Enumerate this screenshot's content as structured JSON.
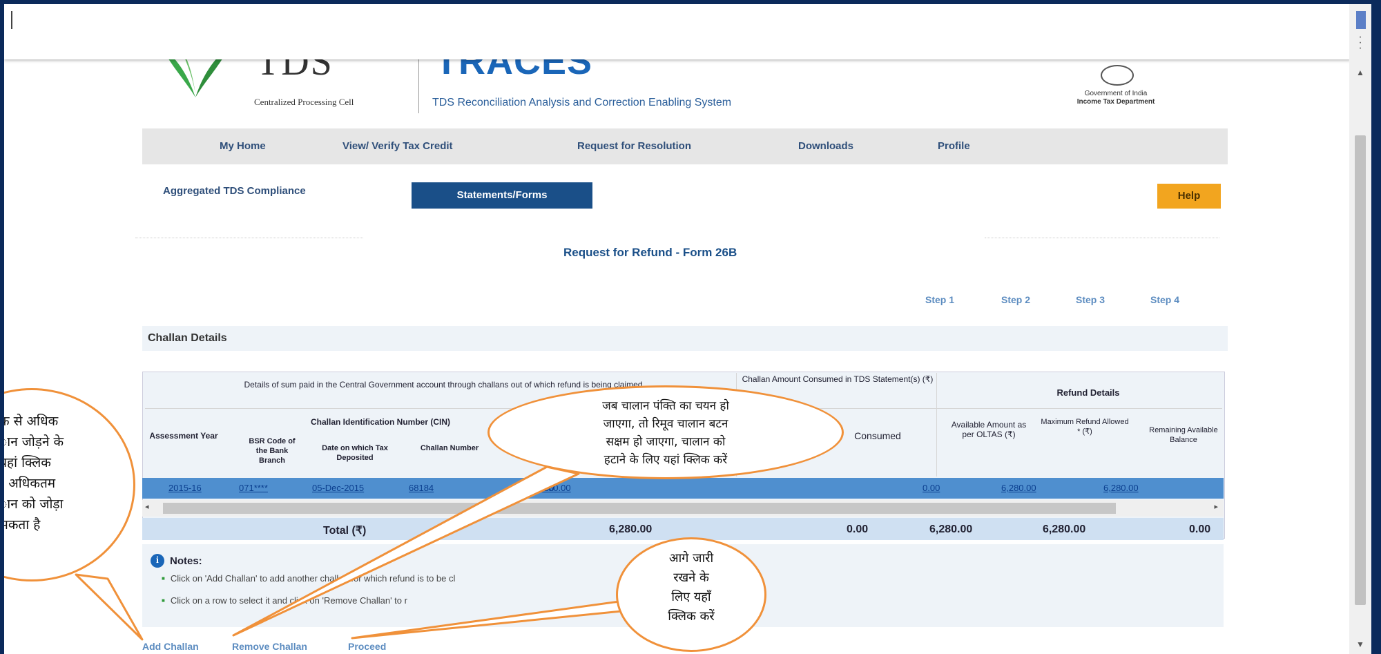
{
  "header": {
    "tds_logo_text": "TDS",
    "tds_subtitle": "Centralized Processing Cell",
    "traces_title": "TRACES",
    "traces_subtitle": "TDS Reconciliation Analysis and Correction Enabling System",
    "gov_text_line1": "Government of India",
    "gov_text_line2": "Income Tax Department"
  },
  "nav": {
    "items": [
      "My Home",
      "View/ Verify Tax Credit",
      "Request for Resolution",
      "Downloads",
      "Profile"
    ]
  },
  "subnav": {
    "aggregated": "Aggregated TDS Compliance",
    "statements": "Statements/Forms",
    "help": "Help"
  },
  "page": {
    "heading": "Request for Refund - Form 26B",
    "steps": [
      "Step 1",
      "Step 2",
      "Step 3",
      "Step 4"
    ],
    "section_title": "Challan Details"
  },
  "table": {
    "group_sum_paid": "Details of sum paid in the Central Government account through challans out of which refund is being claimed",
    "group_consumed": "Challan Amount Consumed in TDS Statement(s) (₹)",
    "group_refund": "Refund Details",
    "group_cin": "Challan Identification Number (CIN)",
    "col_assessment": "Assessment Year",
    "col_bsr": "BSR Code of the Bank Branch",
    "col_date": "Date on which Tax Deposited",
    "col_challan": "Challan Number",
    "col_consumed": "Consumed",
    "col_available": "Available Amount as per OLTAS (₹)",
    "col_maximum": "Maximum Refund Allowed * (₹)",
    "col_remaining": "Remaining Available Balance",
    "row": {
      "assessment_year": "2015-16",
      "bsr": "071****",
      "date": "05-Dec-2015",
      "challan_no": "68184",
      "amount_hidden": "6,280.00",
      "amount": "6,280.00",
      "consumed": "0.00",
      "available": "6,280.00",
      "maximum": "6,280.00"
    },
    "total_label": "Total (₹)",
    "total_amount": "6,280.00",
    "total_consumed": "0.00",
    "total_available": "6,280.00",
    "total_maximum": "6,280.00",
    "total_remaining": "0.00"
  },
  "notes": {
    "title": "Notes:",
    "note1": "Click on 'Add Challan' to add another challan for which refund is to be cl",
    "note2": "Click on a row to select it and click on 'Remove Challan' to r"
  },
  "actions": {
    "add": "Add Challan",
    "remove": "Remove Challan",
    "proceed": "Proceed"
  },
  "callouts": {
    "add_lines": [
      "क से अधिक",
      "ान जोड़ने के",
      "यहां क्लिक",
      "। अधिकतम",
      "ान को जोड़ा",
      "सकता है"
    ],
    "remove_lines": [
      "जब चालान पंक्ति का चयन हो",
      "जाएगा, तो रिमूव चालान बटन",
      "सक्षम हो जाएगा, चालान को",
      "हटाने के लिए यहां क्लिक करें"
    ],
    "proceed_lines": [
      "आगे जारी",
      "रखने के",
      "लिए यहाँ",
      "क्लिक करें"
    ]
  },
  "colors": {
    "accent": "#1a4f88",
    "callout_border": "#f0913a",
    "help": "#f2a51f",
    "selected_row": "#4f8fcf"
  }
}
